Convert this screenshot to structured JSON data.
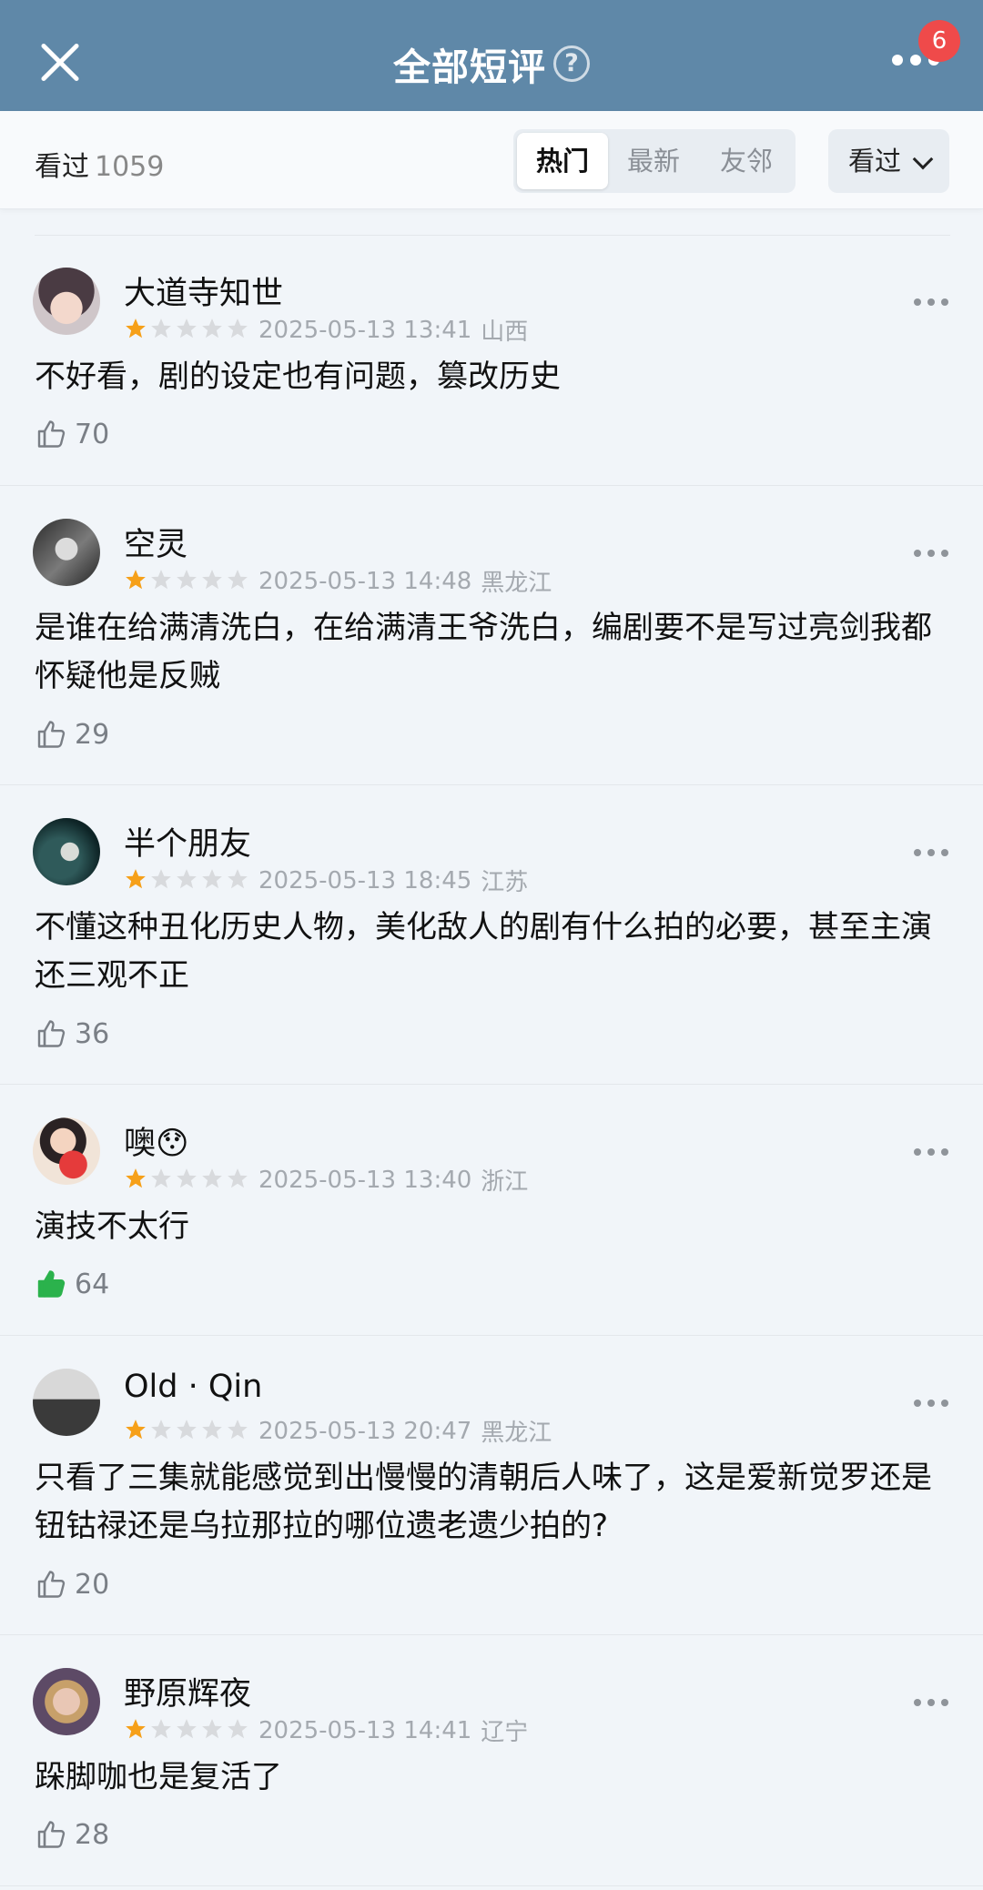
{
  "header": {
    "title": "全部短评",
    "help_icon": "question-circle-icon",
    "close_icon": "close-icon",
    "more_icon": "more-horizontal-icon",
    "badge_count": "6",
    "bg_color": "#5f88a8",
    "badge_color": "#ef4a4a"
  },
  "filter": {
    "seen_label": "看过",
    "seen_count": "1059",
    "tabs": [
      "热门",
      "最新",
      "友邻"
    ],
    "active_tab": "热门",
    "dropdown_label": "看过"
  },
  "reviews": [
    {
      "username": "大道寺知世",
      "rating": 1,
      "max_rating": 5,
      "datetime": "2025-05-13 13:41",
      "location": "山西",
      "content": "不好看，剧的设定也有问题，篡改历史",
      "likes": "70",
      "liked": false
    },
    {
      "username": "空灵",
      "rating": 1,
      "max_rating": 5,
      "datetime": "2025-05-13 14:48",
      "location": "黑龙江",
      "content": "是谁在给满清洗白，在给满清王爷洗白，编剧要不是写过亮剑我都怀疑他是反贼",
      "likes": "29",
      "liked": false
    },
    {
      "username": "半个朋友",
      "rating": 1,
      "max_rating": 5,
      "datetime": "2025-05-13 18:45",
      "location": "江苏",
      "content": "不懂这种丑化历史人物，美化敌人的剧有什么拍的必要，甚至主演还三观不正",
      "likes": "36",
      "liked": false
    },
    {
      "username": "噢😯",
      "rating": 1,
      "max_rating": 5,
      "datetime": "2025-05-13 13:40",
      "location": "浙江",
      "content": "演技不太行",
      "likes": "64",
      "liked": true
    },
    {
      "username": "Old · Qin",
      "rating": 1,
      "max_rating": 5,
      "datetime": "2025-05-13 20:47",
      "location": "黑龙江",
      "content": "只看了三集就能感觉到出慢慢的清朝后人味了，这是爱新觉罗还是钮钴禄还是乌拉那拉的哪位遗老遗少拍的?",
      "likes": "20",
      "liked": false
    },
    {
      "username": "野原辉夜",
      "rating": 1,
      "max_rating": 5,
      "datetime": "2025-05-13 14:41",
      "location": "辽宁",
      "content": "跺脚咖也是复活了",
      "likes": "28",
      "liked": false
    }
  ],
  "colors": {
    "star_on": "#f6a019",
    "star_off": "#d8dadd",
    "liked": "#2bb24c"
  }
}
